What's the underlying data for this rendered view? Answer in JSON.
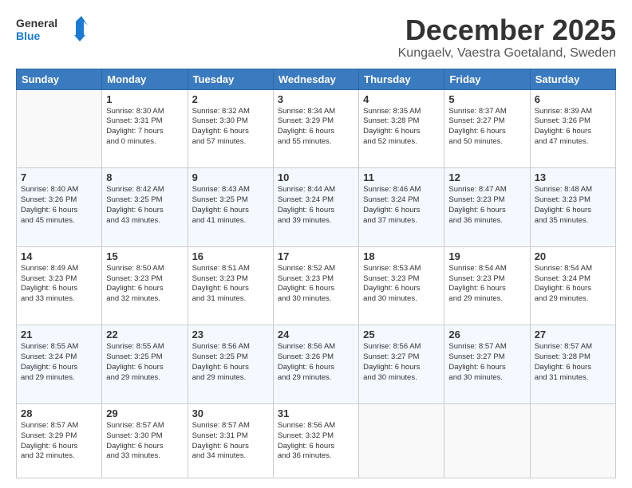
{
  "header": {
    "logo_line1": "General",
    "logo_line2": "Blue",
    "month": "December 2025",
    "location": "Kungaelv, Vaestra Goetaland, Sweden"
  },
  "weekdays": [
    "Sunday",
    "Monday",
    "Tuesday",
    "Wednesday",
    "Thursday",
    "Friday",
    "Saturday"
  ],
  "weeks": [
    [
      {
        "day": "",
        "info": ""
      },
      {
        "day": "1",
        "info": "Sunrise: 8:30 AM\nSunset: 3:31 PM\nDaylight: 7 hours\nand 0 minutes."
      },
      {
        "day": "2",
        "info": "Sunrise: 8:32 AM\nSunset: 3:30 PM\nDaylight: 6 hours\nand 57 minutes."
      },
      {
        "day": "3",
        "info": "Sunrise: 8:34 AM\nSunset: 3:29 PM\nDaylight: 6 hours\nand 55 minutes."
      },
      {
        "day": "4",
        "info": "Sunrise: 8:35 AM\nSunset: 3:28 PM\nDaylight: 6 hours\nand 52 minutes."
      },
      {
        "day": "5",
        "info": "Sunrise: 8:37 AM\nSunset: 3:27 PM\nDaylight: 6 hours\nand 50 minutes."
      },
      {
        "day": "6",
        "info": "Sunrise: 8:39 AM\nSunset: 3:26 PM\nDaylight: 6 hours\nand 47 minutes."
      }
    ],
    [
      {
        "day": "7",
        "info": "Sunrise: 8:40 AM\nSunset: 3:26 PM\nDaylight: 6 hours\nand 45 minutes."
      },
      {
        "day": "8",
        "info": "Sunrise: 8:42 AM\nSunset: 3:25 PM\nDaylight: 6 hours\nand 43 minutes."
      },
      {
        "day": "9",
        "info": "Sunrise: 8:43 AM\nSunset: 3:25 PM\nDaylight: 6 hours\nand 41 minutes."
      },
      {
        "day": "10",
        "info": "Sunrise: 8:44 AM\nSunset: 3:24 PM\nDaylight: 6 hours\nand 39 minutes."
      },
      {
        "day": "11",
        "info": "Sunrise: 8:46 AM\nSunset: 3:24 PM\nDaylight: 6 hours\nand 37 minutes."
      },
      {
        "day": "12",
        "info": "Sunrise: 8:47 AM\nSunset: 3:23 PM\nDaylight: 6 hours\nand 36 minutes."
      },
      {
        "day": "13",
        "info": "Sunrise: 8:48 AM\nSunset: 3:23 PM\nDaylight: 6 hours\nand 35 minutes."
      }
    ],
    [
      {
        "day": "14",
        "info": "Sunrise: 8:49 AM\nSunset: 3:23 PM\nDaylight: 6 hours\nand 33 minutes."
      },
      {
        "day": "15",
        "info": "Sunrise: 8:50 AM\nSunset: 3:23 PM\nDaylight: 6 hours\nand 32 minutes."
      },
      {
        "day": "16",
        "info": "Sunrise: 8:51 AM\nSunset: 3:23 PM\nDaylight: 6 hours\nand 31 minutes."
      },
      {
        "day": "17",
        "info": "Sunrise: 8:52 AM\nSunset: 3:23 PM\nDaylight: 6 hours\nand 30 minutes."
      },
      {
        "day": "18",
        "info": "Sunrise: 8:53 AM\nSunset: 3:23 PM\nDaylight: 6 hours\nand 30 minutes."
      },
      {
        "day": "19",
        "info": "Sunrise: 8:54 AM\nSunset: 3:23 PM\nDaylight: 6 hours\nand 29 minutes."
      },
      {
        "day": "20",
        "info": "Sunrise: 8:54 AM\nSunset: 3:24 PM\nDaylight: 6 hours\nand 29 minutes."
      }
    ],
    [
      {
        "day": "21",
        "info": "Sunrise: 8:55 AM\nSunset: 3:24 PM\nDaylight: 6 hours\nand 29 minutes."
      },
      {
        "day": "22",
        "info": "Sunrise: 8:55 AM\nSunset: 3:25 PM\nDaylight: 6 hours\nand 29 minutes."
      },
      {
        "day": "23",
        "info": "Sunrise: 8:56 AM\nSunset: 3:25 PM\nDaylight: 6 hours\nand 29 minutes."
      },
      {
        "day": "24",
        "info": "Sunrise: 8:56 AM\nSunset: 3:26 PM\nDaylight: 6 hours\nand 29 minutes."
      },
      {
        "day": "25",
        "info": "Sunrise: 8:56 AM\nSunset: 3:27 PM\nDaylight: 6 hours\nand 30 minutes."
      },
      {
        "day": "26",
        "info": "Sunrise: 8:57 AM\nSunset: 3:27 PM\nDaylight: 6 hours\nand 30 minutes."
      },
      {
        "day": "27",
        "info": "Sunrise: 8:57 AM\nSunset: 3:28 PM\nDaylight: 6 hours\nand 31 minutes."
      }
    ],
    [
      {
        "day": "28",
        "info": "Sunrise: 8:57 AM\nSunset: 3:29 PM\nDaylight: 6 hours\nand 32 minutes."
      },
      {
        "day": "29",
        "info": "Sunrise: 8:57 AM\nSunset: 3:30 PM\nDaylight: 6 hours\nand 33 minutes."
      },
      {
        "day": "30",
        "info": "Sunrise: 8:57 AM\nSunset: 3:31 PM\nDaylight: 6 hours\nand 34 minutes."
      },
      {
        "day": "31",
        "info": "Sunrise: 8:56 AM\nSunset: 3:32 PM\nDaylight: 6 hours\nand 36 minutes."
      },
      {
        "day": "",
        "info": ""
      },
      {
        "day": "",
        "info": ""
      },
      {
        "day": "",
        "info": ""
      }
    ]
  ]
}
